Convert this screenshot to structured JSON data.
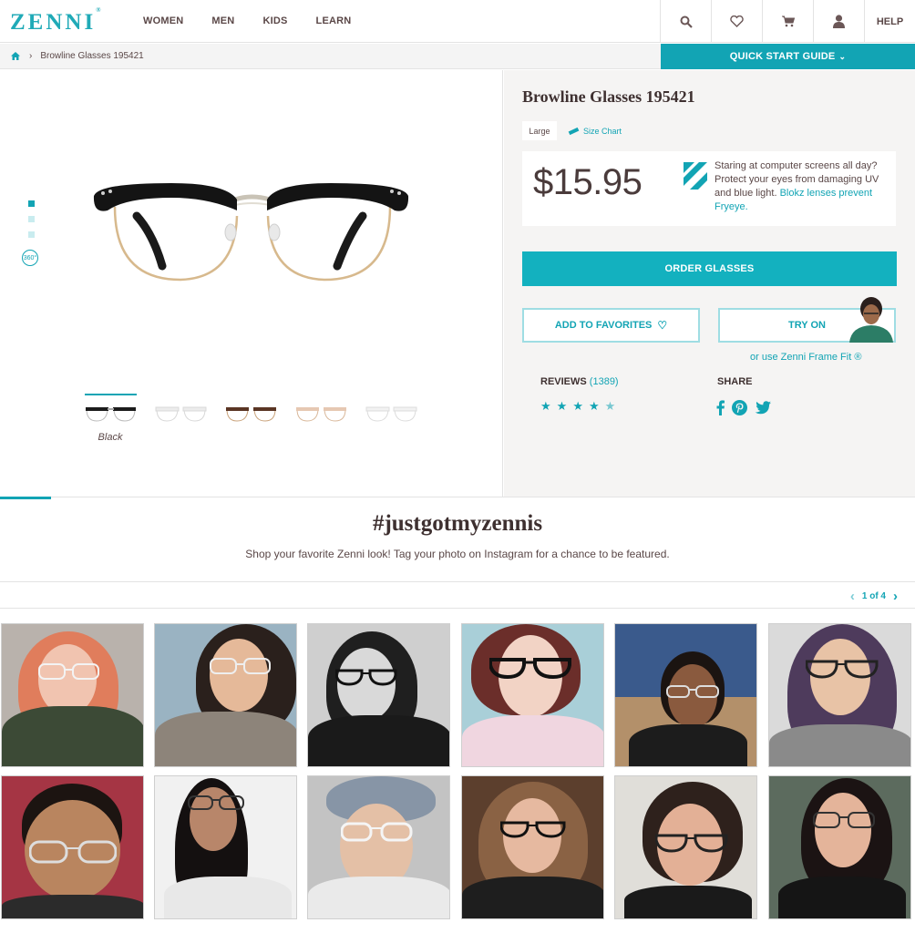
{
  "nav": {
    "logo": "ZENNI",
    "logo_mark": "®",
    "links": [
      "WOMEN",
      "MEN",
      "KIDS",
      "LEARN"
    ],
    "help": "HELP",
    "icons": [
      "search-icon",
      "heart-icon",
      "cart-icon",
      "user-icon"
    ]
  },
  "breadcrumb": {
    "current": "Browline Glasses 195421",
    "quick_start": "QUICK START GUIDE"
  },
  "gallery": {
    "label_360": "360°",
    "selected_color": "Black",
    "swatches": [
      "Black",
      "Clear",
      "Tortoiseshell",
      "Rose",
      "Clear"
    ]
  },
  "product": {
    "title": "Browline Glasses 195421",
    "size": "Large",
    "size_chart": "Size Chart",
    "price": "$15.95",
    "promo_text": "Staring at computer screens all day? Protect your eyes from damaging UV and blue light.",
    "promo_link": "Blokz lenses prevent Fryeye.",
    "order_button": "ORDER GLASSES",
    "favorites_button": "ADD TO FAVORITES",
    "try_on_button": "TRY ON",
    "frame_fit": "or use Zenni Frame Fit ®",
    "reviews_label": "REVIEWS",
    "reviews_count": "(1389)",
    "rating": 4.5,
    "share_label": "SHARE",
    "share_icons": [
      "facebook-icon",
      "pinterest-icon",
      "twitter-icon"
    ]
  },
  "community": {
    "hashtag": "#justgotmyzennis",
    "subline": "Shop your favorite Zenni look! Tag your photo on Instagram for a chance to be featured.",
    "pager": "1 of 4"
  },
  "colors": {
    "brand": "#12a4b4",
    "text": "#4a3b3b",
    "panel": "#f5f4f3"
  }
}
